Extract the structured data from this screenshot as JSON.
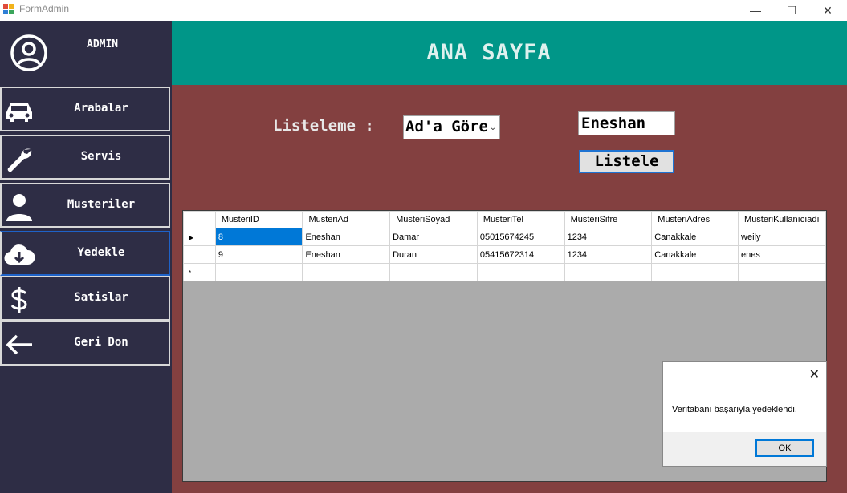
{
  "window": {
    "title": "FormAdmin",
    "min_glyph": "—",
    "max_glyph": "☐",
    "close_glyph": "✕"
  },
  "sidebar": {
    "user_label": "ADMIN",
    "items": [
      {
        "label": "Arabalar",
        "icon": "car-icon"
      },
      {
        "label": "Servis",
        "icon": "wrench-icon"
      },
      {
        "label": "Musteriler",
        "icon": "user-icon"
      },
      {
        "label": "Yedekle",
        "icon": "cloud-download-icon"
      },
      {
        "label": "Satislar",
        "icon": "dollar-icon"
      },
      {
        "label": "Geri Don",
        "icon": "arrow-left-icon"
      }
    ]
  },
  "header": {
    "title": "ANA SAYFA"
  },
  "filter": {
    "label": "Listeleme :",
    "combo_value": "Ad'a Göre",
    "search_value": "Eneshan",
    "button_label": "Listele"
  },
  "grid": {
    "columns": [
      "MusteriID",
      "MusteriAd",
      "MusteriSoyad",
      "MusteriTel",
      "MusteriSifre",
      "MusteriAdres",
      "MusteriKullanıcıadı"
    ],
    "rows": [
      [
        "8",
        "Eneshan",
        "Damar",
        "05015674245",
        "1234",
        "Canakkale",
        "weily"
      ],
      [
        "9",
        "Eneshan",
        "Duran",
        "05415672314",
        "1234",
        "Canakkale",
        "enes"
      ]
    ],
    "current_marker": "▶",
    "new_row_marker": "*"
  },
  "dialog": {
    "message": "Veritabanı başarıyla yedeklendi.",
    "ok_label": "OK",
    "close_glyph": "✕"
  },
  "colors": {
    "sidebar": "#2e2d45",
    "header": "#009688",
    "main": "#834040",
    "selection": "#0078d7"
  }
}
